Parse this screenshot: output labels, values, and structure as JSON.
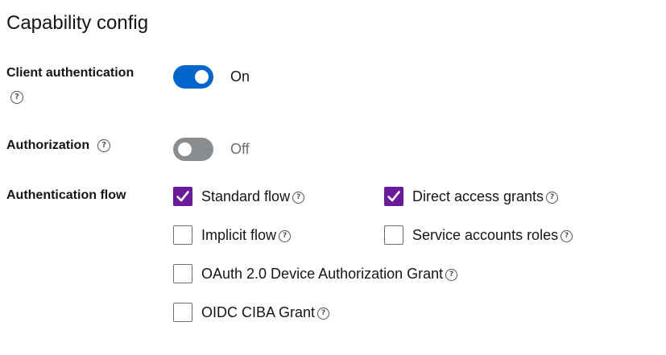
{
  "section": {
    "title": "Capability config"
  },
  "client_authentication": {
    "label": "Client authentication",
    "state": "On",
    "enabled": true
  },
  "authorization": {
    "label": "Authorization",
    "state": "Off",
    "enabled": false
  },
  "authentication_flow": {
    "label": "Authentication flow",
    "options": [
      {
        "label": "Standard flow",
        "checked": true
      },
      {
        "label": "Direct access grants",
        "checked": true
      },
      {
        "label": "Implicit flow",
        "checked": false
      },
      {
        "label": "Service accounts roles",
        "checked": false
      },
      {
        "label": "OAuth 2.0 Device Authorization Grant",
        "checked": false
      },
      {
        "label": "OIDC CIBA Grant",
        "checked": false
      }
    ]
  },
  "colors": {
    "toggle_on": "#0066cc",
    "toggle_off": "#8a8d90",
    "checkbox_checked": "#6a1b9a"
  },
  "icons": {
    "help": "question-circle-icon",
    "check": "checkmark-icon"
  }
}
